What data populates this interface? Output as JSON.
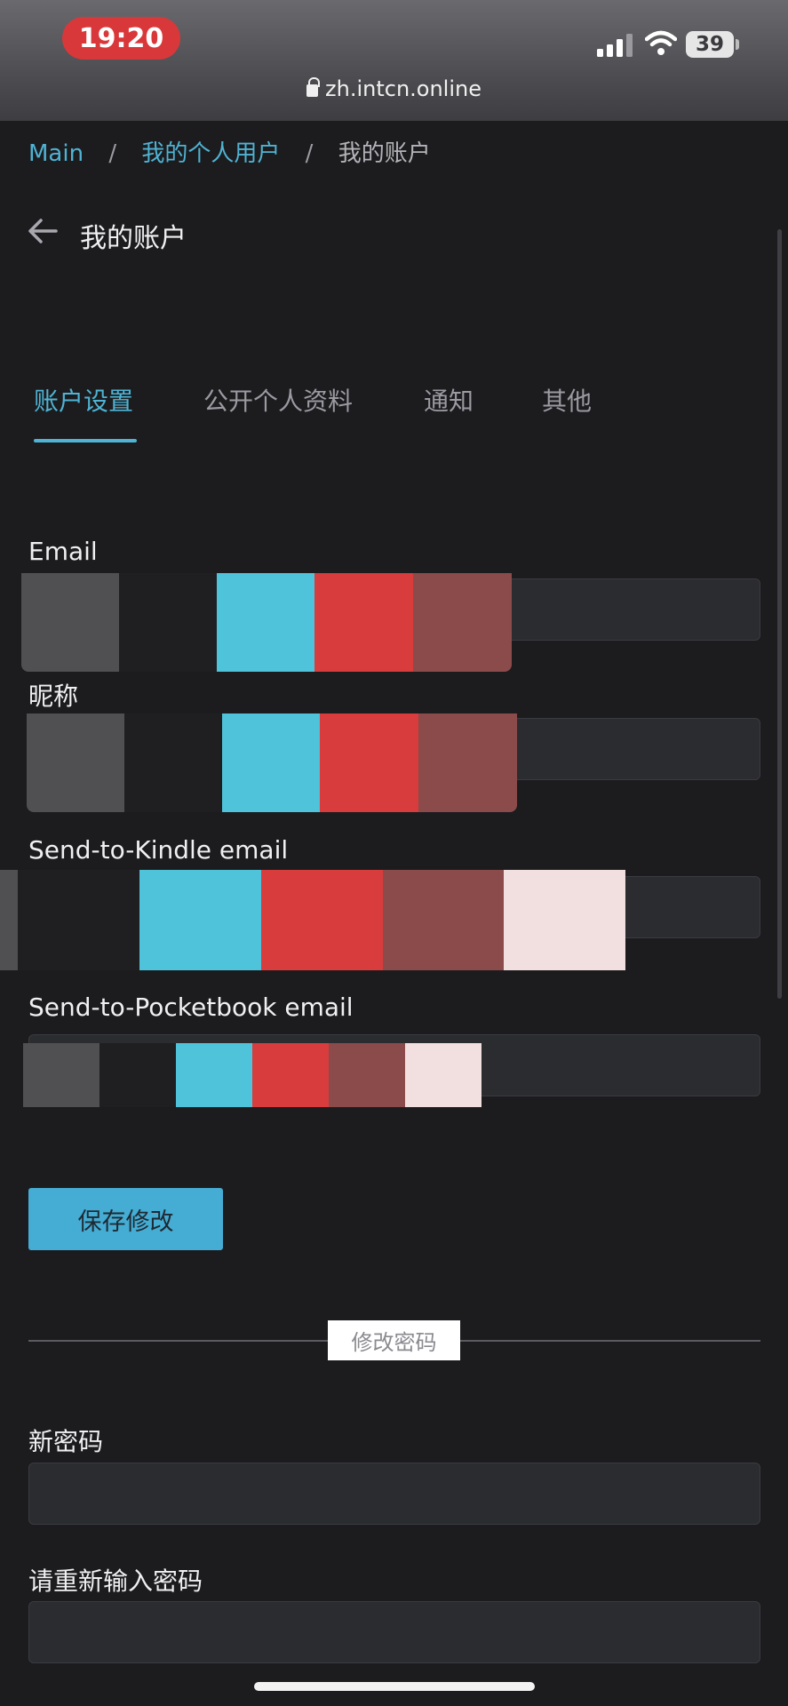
{
  "status_bar": {
    "time": "19:20",
    "battery": "39",
    "signal_icon": "cellular-signal-icon",
    "wifi_icon": "wifi-icon"
  },
  "browser": {
    "url": "zh.intcn.online",
    "lock_icon": "lock-icon"
  },
  "breadcrumb": {
    "items": [
      "Main",
      "我的个人用户",
      "我的账户"
    ],
    "separator": "/"
  },
  "header": {
    "back_icon": "arrow-left-icon",
    "title": "我的账户"
  },
  "tabs": [
    {
      "label": "账户设置",
      "active": true
    },
    {
      "label": "公开个人资料",
      "active": false
    },
    {
      "label": "通知",
      "active": false
    },
    {
      "label": "其他",
      "active": false
    }
  ],
  "form": {
    "email_label": "Email",
    "nickname_label": "昵称",
    "kindle_label": "Send-to-Kindle email",
    "pocketbook_label": "Send-to-Pocketbook email",
    "save_label": "保存修改"
  },
  "password": {
    "divider_label": "修改密码",
    "new_label": "新密码",
    "repeat_label": "请重新输入密码"
  },
  "colors": {
    "accent": "#4fb3d3",
    "button": "#45acd3",
    "background": "#1c1c1f",
    "input": "#2b2c30",
    "time_pill": "#d9383a"
  }
}
